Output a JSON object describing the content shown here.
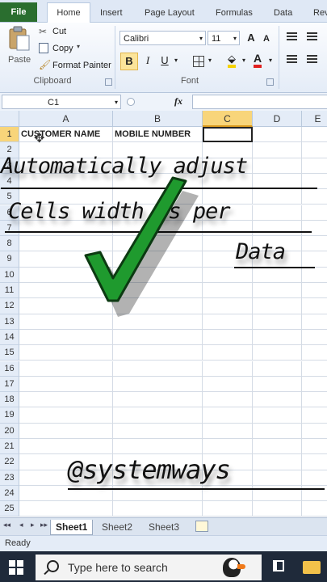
{
  "ribbon_tabs": [
    "File",
    "Home",
    "Insert",
    "Page Layout",
    "Formulas",
    "Data",
    "Rev"
  ],
  "clipboard": {
    "paste": "Paste",
    "cut": "Cut",
    "copy": "Copy",
    "format_painter": "Format Painter",
    "label": "Clipboard"
  },
  "font": {
    "name": "Calibri",
    "size": "11",
    "label": "Font",
    "bold": "B",
    "italic": "I",
    "underline": "U",
    "grow": "A",
    "shrink": "A"
  },
  "formula_bar": {
    "name_box": "C1",
    "fx": "fx",
    "value": ""
  },
  "columns": [
    "A",
    "B",
    "C",
    "D",
    "E"
  ],
  "rows": [
    "1",
    "2",
    "3",
    "4",
    "5",
    "6",
    "7",
    "8",
    "9",
    "10",
    "11",
    "12",
    "13",
    "14",
    "15",
    "16",
    "17",
    "18",
    "19",
    "20",
    "21",
    "22",
    "23",
    "24",
    "25"
  ],
  "cells": {
    "A1": "CUSTOMER NAME",
    "B1": "MOBILE NUMBER"
  },
  "sheets": [
    "Sheet1",
    "Sheet2",
    "Sheet3"
  ],
  "status": "Ready",
  "taskbar": {
    "search_placeholder": "Type here to search"
  },
  "overlay": {
    "line1": "Automatically adjust",
    "line2": "Cells width as per",
    "line3": "Data",
    "handle": "@systemways"
  },
  "colors": {
    "file_tab": "#2a6e2f",
    "checkmark": "#1f9a2e",
    "accent_header": "#f8d57a",
    "taskbar": "#1f2a3a"
  }
}
